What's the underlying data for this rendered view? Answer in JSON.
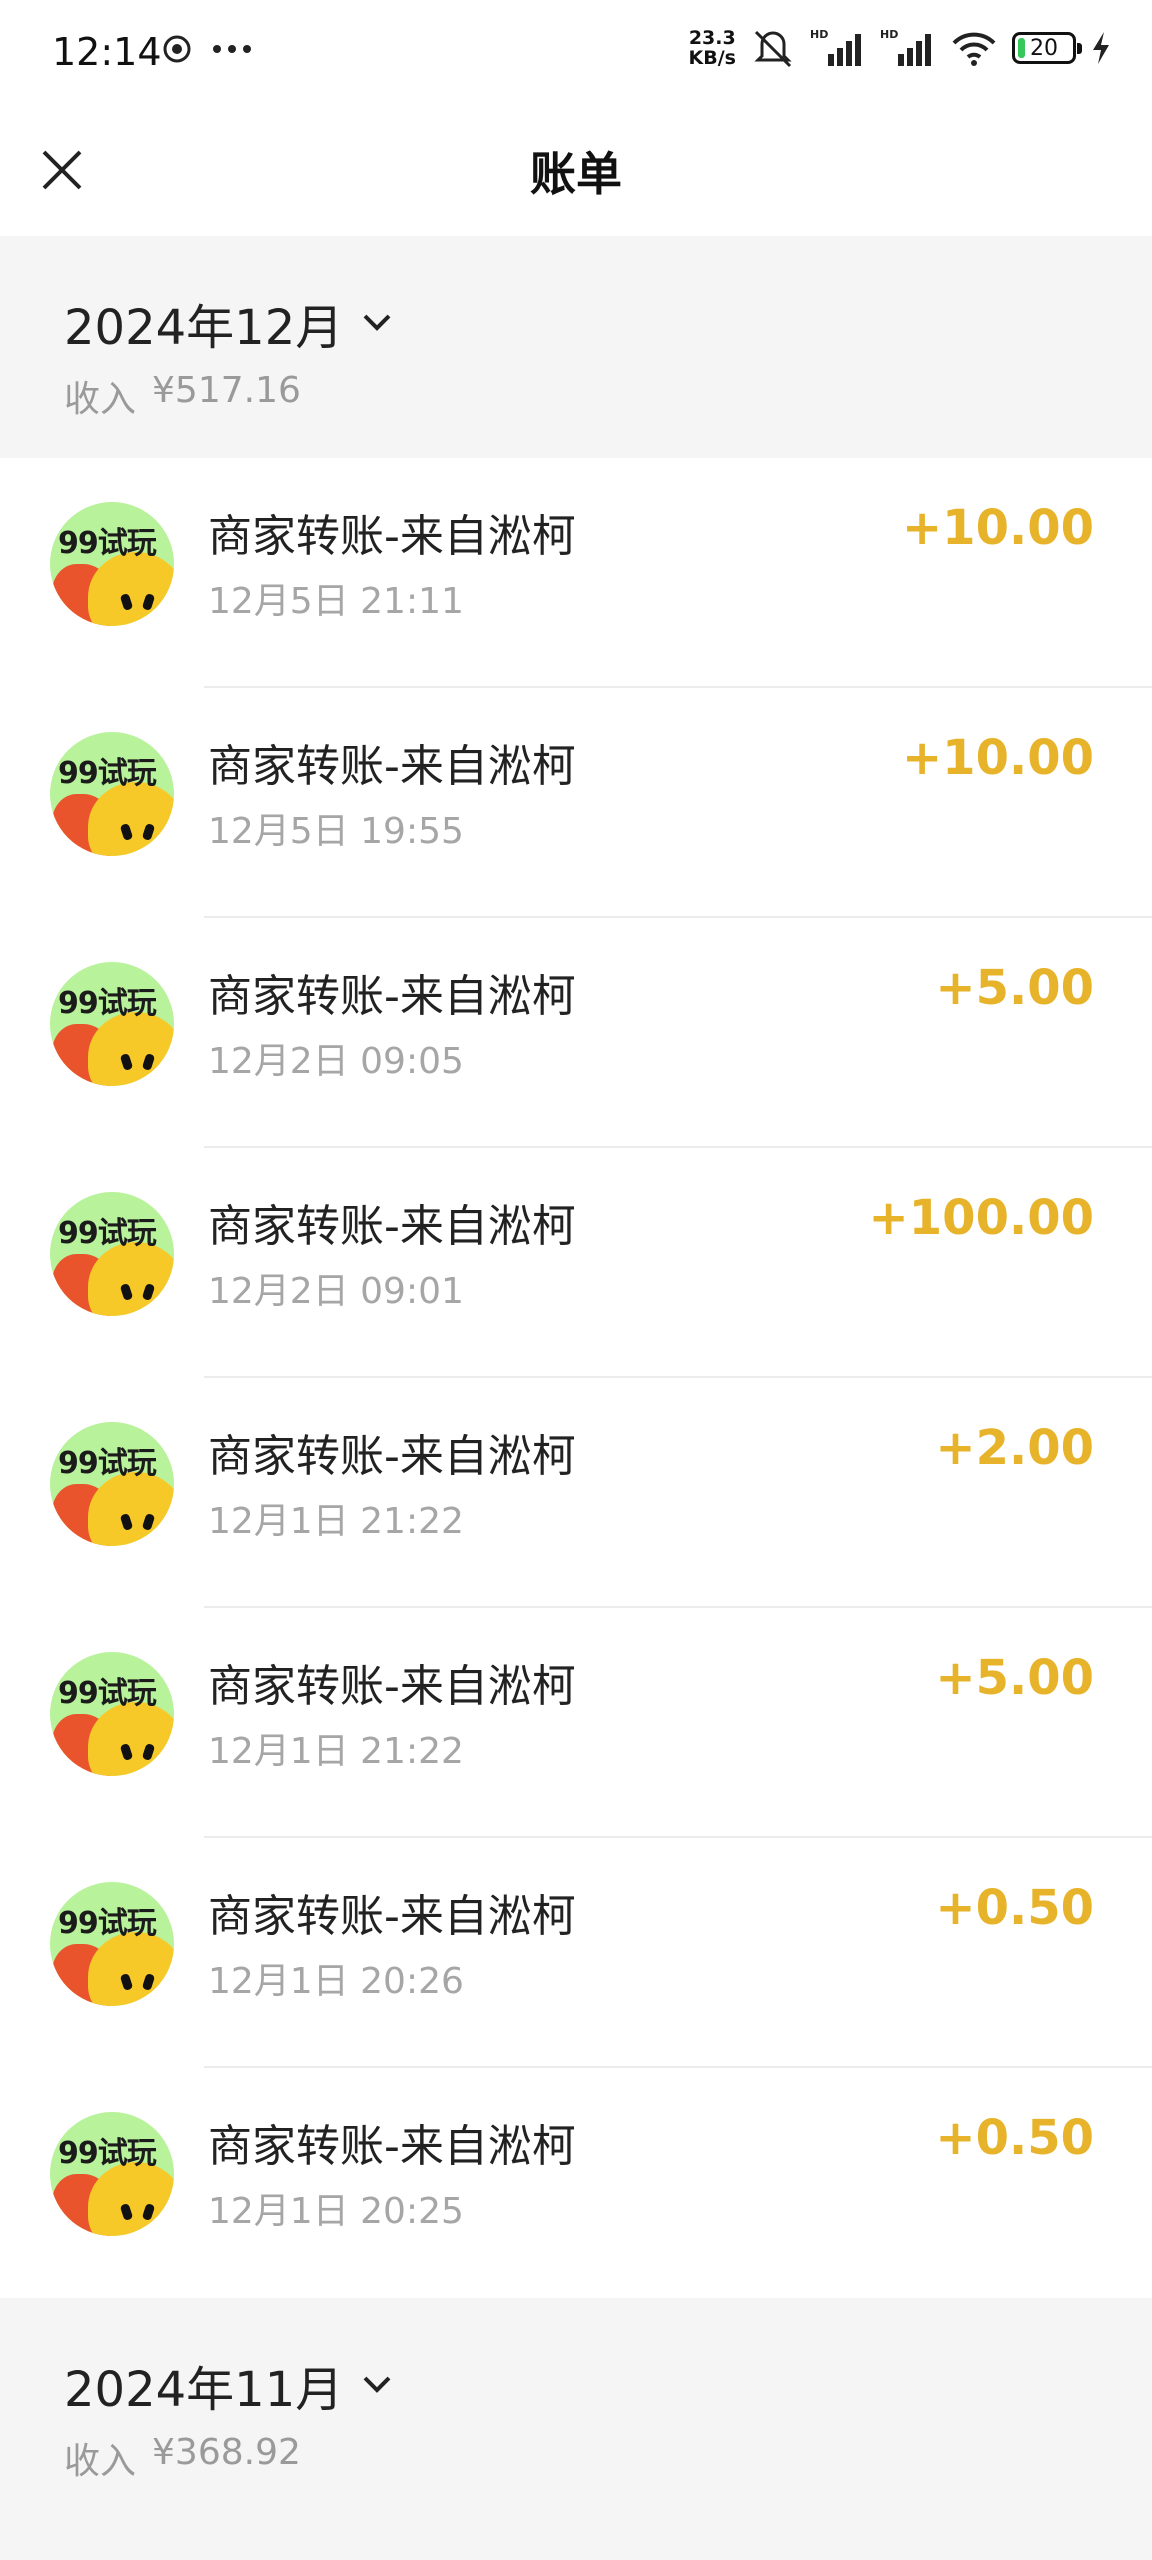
{
  "status_bar": {
    "time": "12:14",
    "speed_value": "23.3",
    "speed_unit": "KB/s",
    "battery": "20",
    "icons": [
      "camera-icon",
      "more-dots-icon",
      "mute-icon",
      "signal-icon",
      "wifi-icon",
      "battery-icon",
      "charging-icon"
    ]
  },
  "header": {
    "title": "账单",
    "close_icon": "close-icon"
  },
  "months": [
    {
      "label": "2024年12月",
      "income_label": "收入",
      "income_value": "¥517.16"
    },
    {
      "label": "2024年11月",
      "income_label": "收入",
      "income_value": "¥368.92"
    }
  ],
  "transactions": [
    {
      "title": "商家转账-来自淞柯",
      "time": "12月5日 21:11",
      "amount": "+10.00"
    },
    {
      "title": "商家转账-来自淞柯",
      "time": "12月5日 19:55",
      "amount": "+10.00"
    },
    {
      "title": "商家转账-来自淞柯",
      "time": "12月2日 09:05",
      "amount": "+5.00"
    },
    {
      "title": "商家转账-来自淞柯",
      "time": "12月2日 09:01",
      "amount": "+100.00"
    },
    {
      "title": "商家转账-来自淞柯",
      "time": "12月1日 21:22",
      "amount": "+2.00"
    },
    {
      "title": "商家转账-来自淞柯",
      "time": "12月1日 21:22",
      "amount": "+5.00"
    },
    {
      "title": "商家转账-来自淞柯",
      "time": "12月1日 20:26",
      "amount": "+0.50"
    },
    {
      "title": "商家转账-来自淞柯",
      "time": "12月1日 20:25",
      "amount": "+0.50"
    }
  ],
  "avatar_text": "99试玩",
  "colors": {
    "amount": "#e7b32a",
    "section_bg": "#f5f5f5",
    "avatar_bg": "#b8f29a"
  }
}
